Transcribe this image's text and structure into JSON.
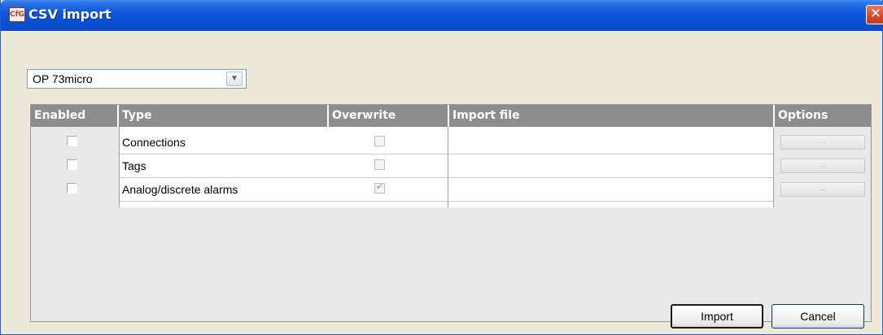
{
  "window": {
    "title": "CSV import",
    "icon": "app-icon",
    "close_label": "✕"
  },
  "device_select": {
    "value": "OP 73micro"
  },
  "table": {
    "headers": [
      "Enabled",
      "Type",
      "Overwrite",
      "Import file",
      "Options"
    ],
    "rows": [
      {
        "enabled": false,
        "type": "Connections",
        "overwrite": false,
        "import_file": "",
        "options_label": "..."
      },
      {
        "enabled": false,
        "type": "Tags",
        "overwrite": false,
        "import_file": "",
        "options_label": "..."
      },
      {
        "enabled": false,
        "type": "Analog/discrete alarms",
        "overwrite": true,
        "import_file": "",
        "options_label": "..."
      }
    ]
  },
  "buttons": {
    "import_label": "Import",
    "cancel_label": "Cancel"
  },
  "colors": {
    "title_bar": "#0a55d8",
    "header_bg": "#8d8d8d",
    "close_button": "#d34a2a"
  }
}
